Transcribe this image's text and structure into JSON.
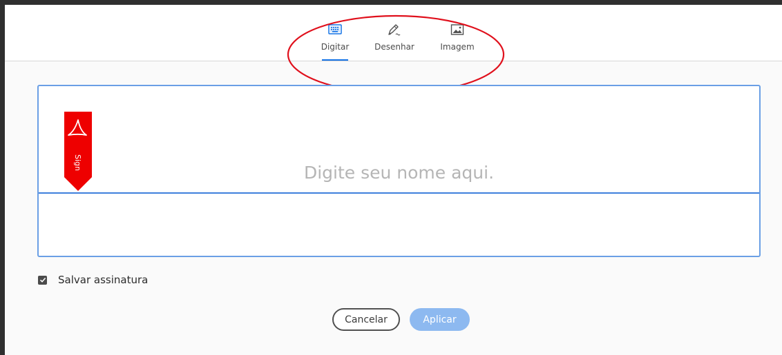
{
  "tabs": [
    {
      "label": "Digitar",
      "icon": "keyboard-icon",
      "active": true
    },
    {
      "label": "Desenhar",
      "icon": "pen-icon",
      "active": false
    },
    {
      "label": "Imagem",
      "icon": "image-icon",
      "active": false
    }
  ],
  "signature": {
    "placeholder": "Digite seu nome aqui.",
    "value": "",
    "ribbon_text": "Sign"
  },
  "save": {
    "label": "Salvar assinatura",
    "checked": true
  },
  "buttons": {
    "cancel": "Cancelar",
    "apply": "Aplicar"
  },
  "colors": {
    "accent": "#1473e6",
    "annotation": "#e0101c",
    "ribbon": "#ee0000",
    "apply_disabled": "#8db9f0"
  }
}
